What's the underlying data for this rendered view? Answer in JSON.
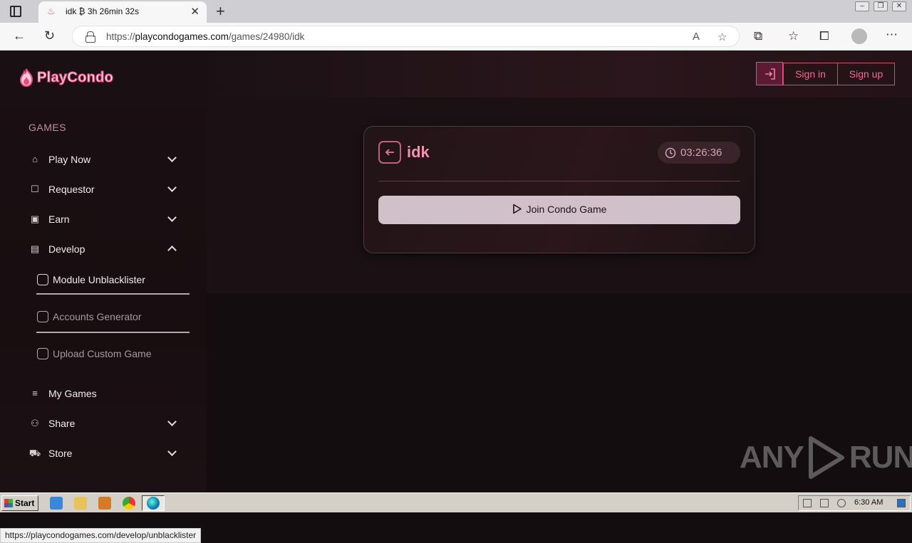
{
  "browser": {
    "tab_title": "idk ₿ 3h 26min 32s",
    "url_prefix": "https://",
    "url_host": "playcondogames.com",
    "url_path": "/games/24980/idk",
    "status_url": "https://playcondogames.com/develop/unblacklister"
  },
  "brand": {
    "logo_text": "PlayCondo",
    "accent": "#e64c7d"
  },
  "sidebar": {
    "section_label": "GAMES",
    "items": [
      {
        "label": "Play Now",
        "icon": "gamepad-icon",
        "expanded": false
      },
      {
        "label": "Requestor",
        "icon": "robot-icon",
        "expanded": false
      },
      {
        "label": "Earn",
        "icon": "cash-icon",
        "expanded": false
      },
      {
        "label": "Develop",
        "icon": "file-code-icon",
        "expanded": true
      },
      {
        "label": "My Games",
        "icon": "list-icon"
      },
      {
        "label": "Share",
        "icon": "share-icon",
        "expanded": false
      },
      {
        "label": "Store",
        "icon": "cart-icon",
        "expanded": false
      }
    ],
    "develop_sub": [
      {
        "label": "Module Unblacklister",
        "icon": "module-icon",
        "color": "#f1ecee"
      },
      {
        "label": "Accounts Generator",
        "icon": "accounts-icon",
        "color": "#a7999f"
      },
      {
        "label": "Upload Custom Game",
        "icon": "folder-icon",
        "color": "#a7999f"
      }
    ]
  },
  "header": {
    "sign_in": "Sign in",
    "sign_up": "Sign up"
  },
  "card": {
    "title": "idk",
    "timer": "03:26:36",
    "join_label": "Join Condo Game"
  },
  "watermark": {
    "left": "ANY",
    "right": "RUN"
  },
  "taskbar": {
    "start_label": "Start",
    "clock": "6:30 AM"
  }
}
